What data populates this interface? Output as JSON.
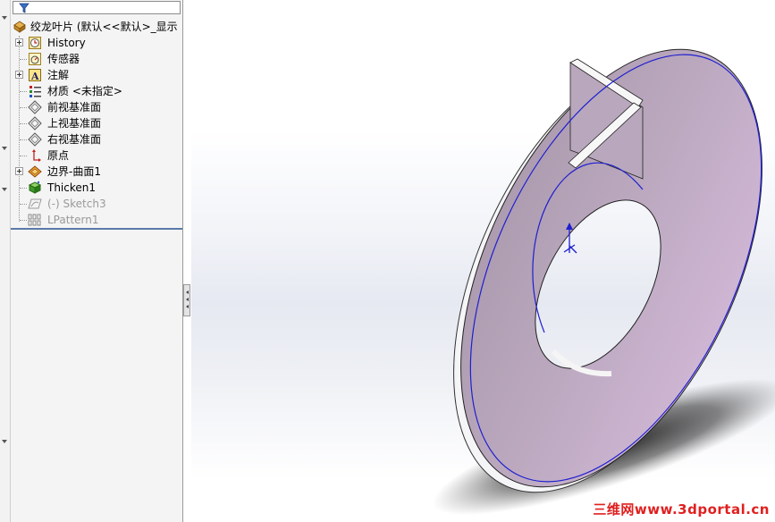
{
  "feature_tree": {
    "root_label": "绞龙叶片 (默认<<默认>_显示",
    "items": [
      {
        "label": "History",
        "icon": "history-icon",
        "expandable": true,
        "dim": false
      },
      {
        "label": "传感器",
        "icon": "sensor-icon",
        "expandable": false,
        "dim": false
      },
      {
        "label": "注解",
        "icon": "annotation-icon",
        "expandable": true,
        "dim": false
      },
      {
        "label": "材质 <未指定>",
        "icon": "material-icon",
        "expandable": false,
        "dim": false
      },
      {
        "label": "前视基准面",
        "icon": "plane-icon",
        "expandable": false,
        "dim": false
      },
      {
        "label": "上视基准面",
        "icon": "plane-icon",
        "expandable": false,
        "dim": false
      },
      {
        "label": "右视基准面",
        "icon": "plane-icon",
        "expandable": false,
        "dim": false
      },
      {
        "label": "原点",
        "icon": "origin-icon",
        "expandable": false,
        "dim": false
      },
      {
        "label": "边界-曲面1",
        "icon": "boundary-surface-icon",
        "expandable": true,
        "dim": false
      },
      {
        "label": "Thicken1",
        "icon": "thicken-icon",
        "expandable": false,
        "dim": false
      },
      {
        "label": "(-) Sketch3",
        "icon": "sketch-icon",
        "expandable": false,
        "dim": true
      },
      {
        "label": "LPattern1",
        "icon": "linear-pattern-icon",
        "expandable": false,
        "dim": true
      }
    ]
  },
  "colors": {
    "part_face": "#c6b3cb",
    "edge_highlight": "#1f1fd0",
    "separator": "#5a7aa8",
    "watermark": "#e02020"
  },
  "watermark": "三维网www.3dportal.cn"
}
